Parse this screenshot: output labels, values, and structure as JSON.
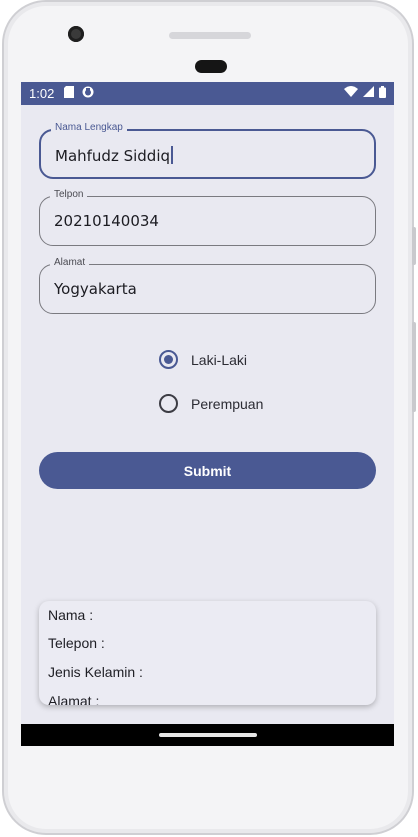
{
  "status_bar": {
    "time": "1:02",
    "left_icons": [
      "sd-card-icon",
      "app-notification-icon"
    ],
    "right_icons": [
      "wifi-icon",
      "cellular-signal-icon",
      "battery-icon"
    ]
  },
  "form": {
    "nama": {
      "label": "Nama Lengkap",
      "value": "Mahfudz Siddiq",
      "focused": true
    },
    "telpon": {
      "label": "Telpon",
      "value": "20210140034"
    },
    "alamat": {
      "label": "Alamat",
      "value": "Yogyakarta"
    }
  },
  "gender": {
    "options": [
      {
        "label": "Laki-Laki",
        "checked": true
      },
      {
        "label": "Perempuan",
        "checked": false
      }
    ]
  },
  "submit_label": "Submit",
  "result": {
    "nama": "Nama :",
    "telepon": "Telepon :",
    "jenis_kelamin": "Jenis Kelamin :",
    "alamat": "Alamat :"
  },
  "colors": {
    "primary": "#4a5993",
    "background": "#e9e9f1",
    "card": "#ebebf3"
  }
}
